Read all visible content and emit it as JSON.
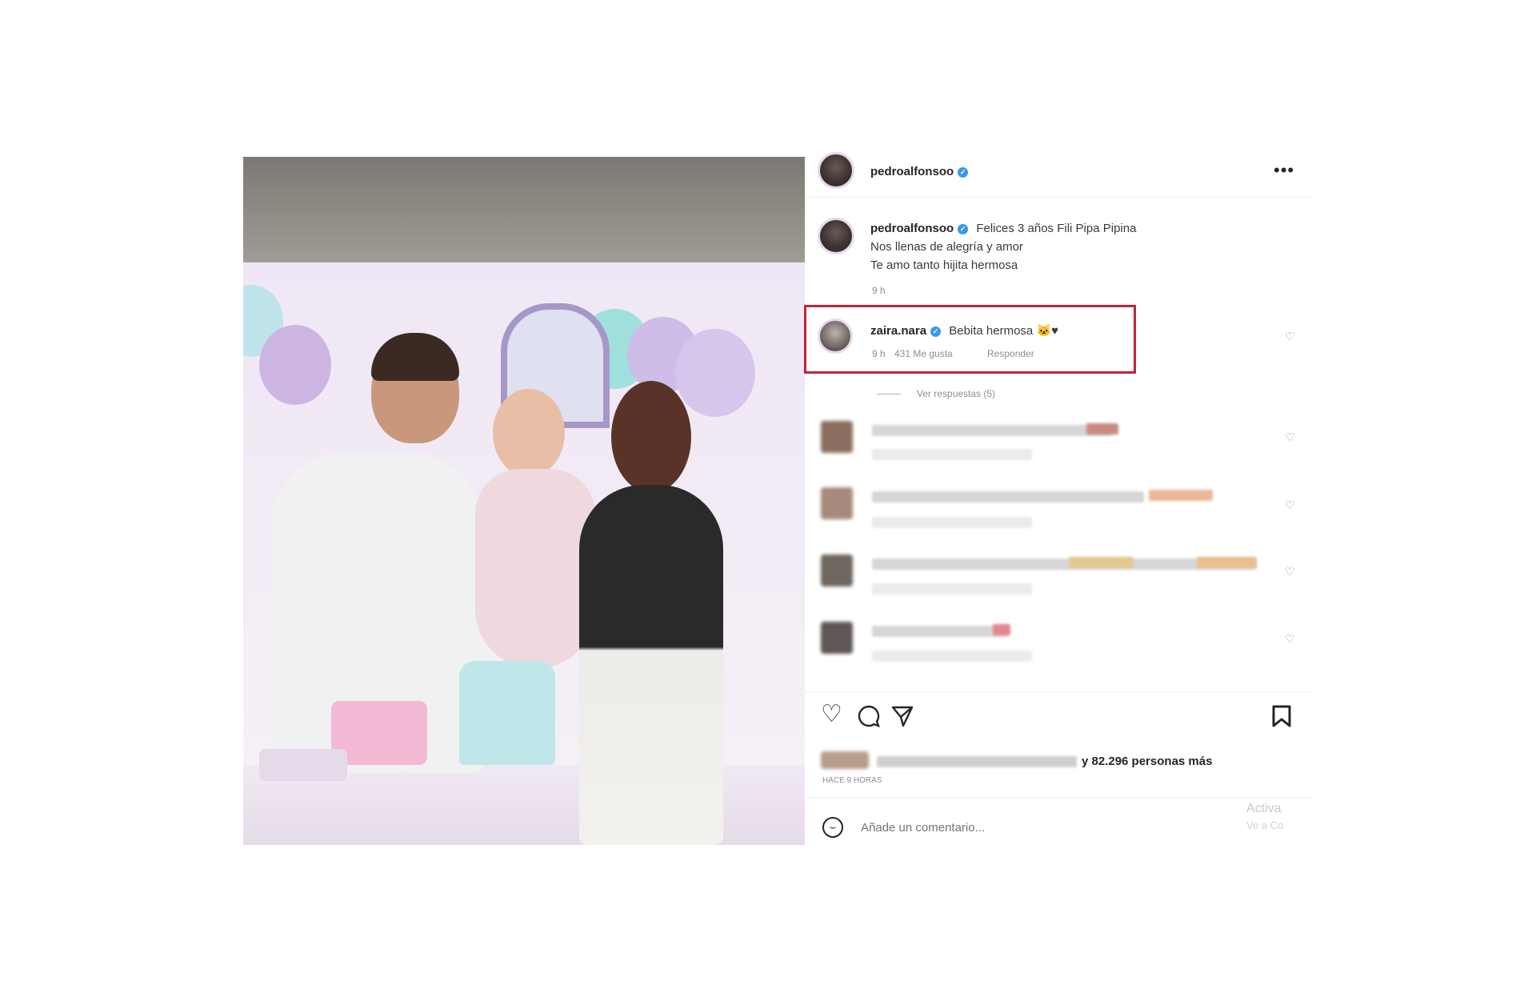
{
  "post": {
    "username": "pedroalfonsoo",
    "more_menu": "•••",
    "caption": {
      "username": "pedroalfonsoo",
      "line1": "Felices 3 años Fili Pipa Pipina",
      "line2": "Nos llenas de alegría y amor",
      "line3": "Te amo tanto hijita hermosa",
      "time": "9 h"
    },
    "highlighted_comment": {
      "username": "zaira.nara",
      "text": "Bebita hermosa 🐱♥",
      "time": "9 h",
      "likes": "431 Me gusta",
      "reply": "Responder"
    },
    "view_replies": "Ver respuestas (5)",
    "likes_summary": "y 82.296 personas más",
    "timestamp": "HACE 9 HORAS",
    "comment_placeholder": "Añade un comentario...",
    "watermark_line1": "Activa",
    "watermark_line2": "Ve a Co"
  },
  "icons": {
    "heart": "heart-icon",
    "comment": "comment-icon",
    "share": "share-icon",
    "bookmark": "bookmark-icon",
    "emoji": "emoji-icon",
    "verified": "verified-badge-icon"
  },
  "colors": {
    "highlight_border": "#c0243a",
    "verified": "#3897f0",
    "meta_text": "#8e8e8e"
  }
}
